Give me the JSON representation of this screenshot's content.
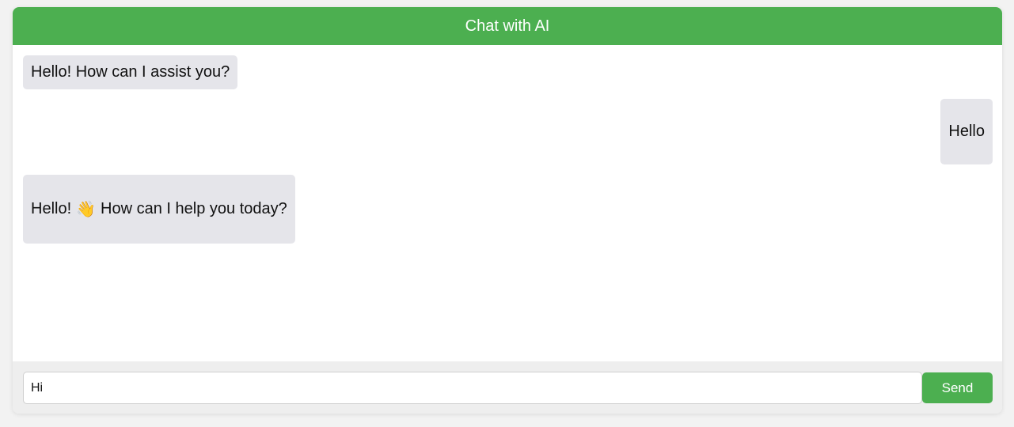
{
  "header": {
    "title": "Chat with AI"
  },
  "messages": [
    {
      "sender": "ai",
      "text": "Hello! How can I assist you?"
    },
    {
      "sender": "user",
      "text": "Hello"
    },
    {
      "sender": "ai",
      "text_before": "Hello!",
      "emoji": "👋",
      "text_after": "How can I help you today?"
    }
  ],
  "input": {
    "value": "Hi",
    "placeholder": ""
  },
  "send_button": {
    "label": "Send"
  },
  "colors": {
    "accent": "#4caf50",
    "bubble": "#e5e5ea",
    "background": "#f2f2f2"
  },
  "icons": {
    "wave": "waving-hand-icon"
  }
}
